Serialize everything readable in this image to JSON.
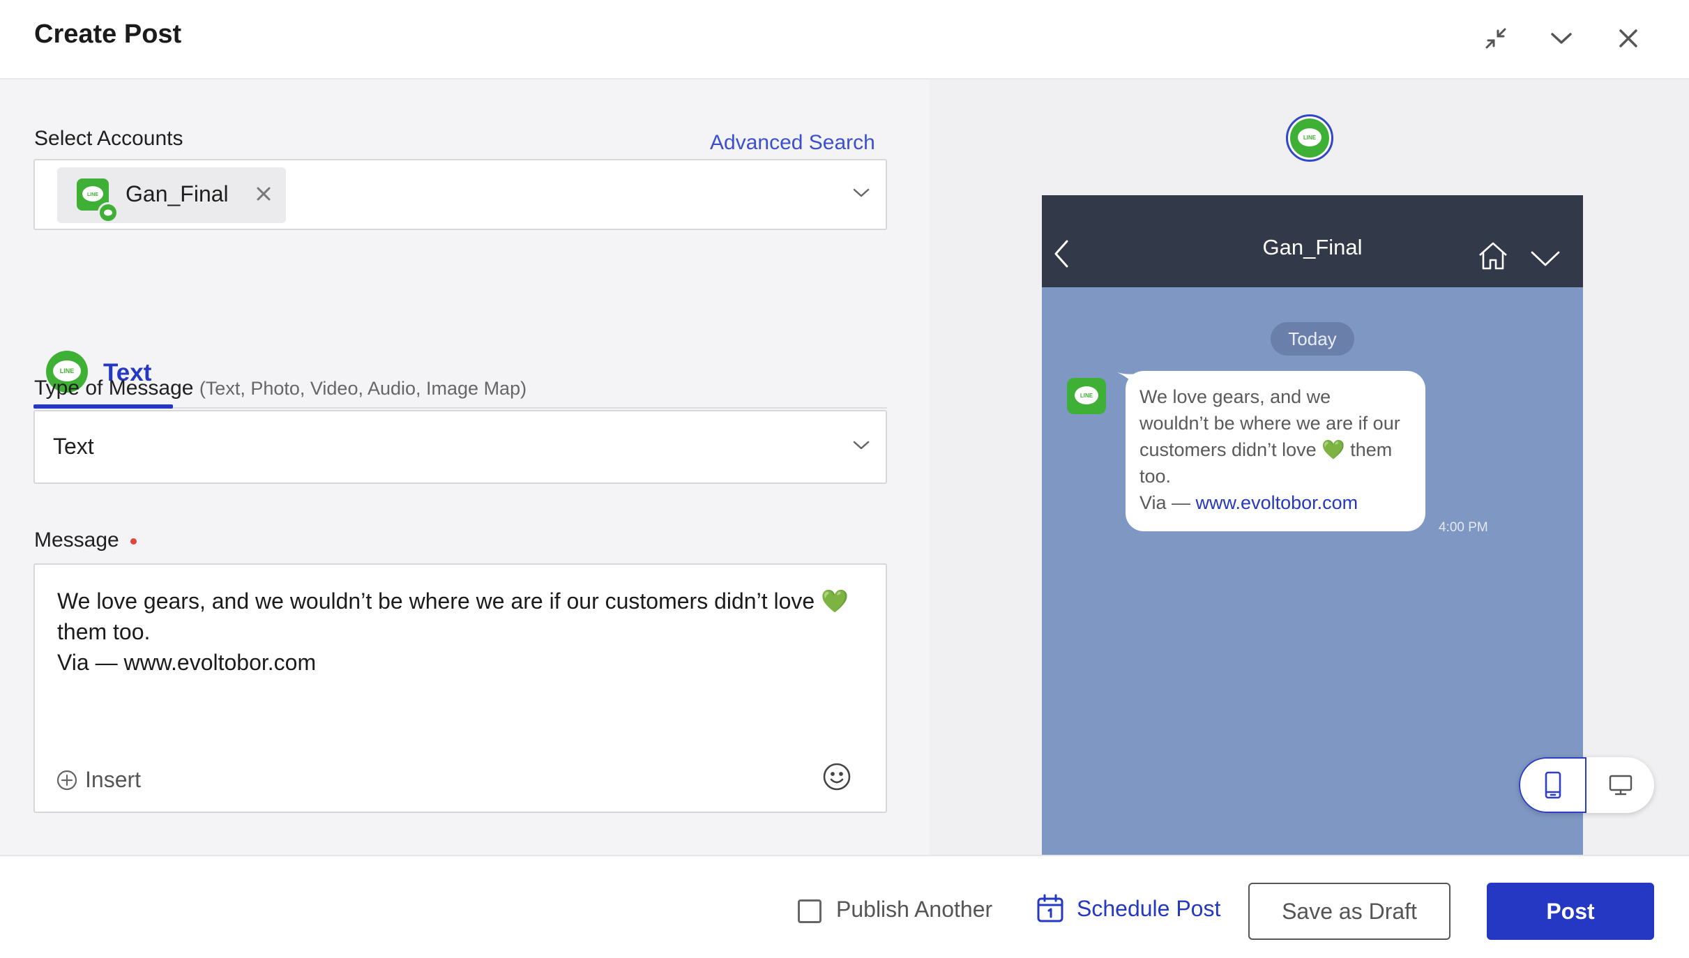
{
  "header": {
    "title": "Create Post"
  },
  "accounts": {
    "label": "Select Accounts",
    "advanced_search": "Advanced Search",
    "selected": [
      {
        "name": "Gan_Final",
        "network": "LINE"
      }
    ]
  },
  "tabs": [
    {
      "label": "Text",
      "icon": "line-icon",
      "active": true
    }
  ],
  "type_of_message": {
    "label": "Type of Message",
    "hint": "(Text, Photo, Video, Audio, Image Map)",
    "value": "Text"
  },
  "message": {
    "label": "Message",
    "required": true,
    "value": "We love gears, and we wouldn’t be where we are if our customers didn’t love 💚\nthem too.\nVia — www.evoltobor.com",
    "insert_label": "Insert"
  },
  "preview": {
    "account_name": "Gan_Final",
    "date_chip": "Today",
    "bubble_text": "We love gears, and we\nwouldn’t be where we are if our\ncustomers didn’t love 💚 them\ntoo.",
    "bubble_via": "Via — ",
    "bubble_link": "www.evoltobor.com",
    "time": "4:00 PM",
    "view_mode": "mobile"
  },
  "footer": {
    "publish_another": "Publish Another",
    "publish_another_checked": false,
    "schedule": "Schedule Post",
    "save_draft": "Save as Draft",
    "post": "Post"
  },
  "colors": {
    "accent": "#2438C4",
    "line_green": "#3FB036",
    "phone_header": "#323949",
    "phone_bg": "#7F97C3",
    "required_dot": "#E0453A"
  }
}
